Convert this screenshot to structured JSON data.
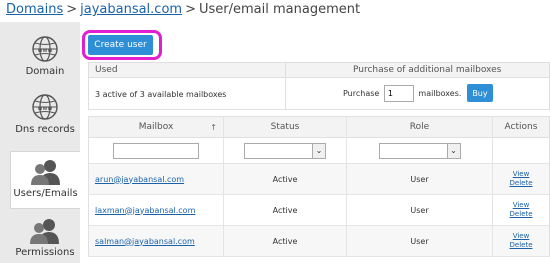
{
  "breadcrumb": {
    "items": [
      "Domains",
      "jayabansal.com"
    ],
    "current": "User/email management",
    "separator": ">"
  },
  "sidebar": {
    "items": [
      {
        "label": "Domain",
        "icon": "globe-icon"
      },
      {
        "label": "Dns records",
        "icon": "globe-icon"
      },
      {
        "label": "Users/Emails",
        "icon": "users-icon",
        "active": true
      },
      {
        "label": "Permissions",
        "icon": "users-icon"
      }
    ]
  },
  "toolbar": {
    "create_label": "Create user"
  },
  "usage": {
    "used_header": "Used",
    "purchase_header": "Purchase of additional mailboxes",
    "used_text": "3 active of 3 available mailboxes",
    "purchase_label": "Purchase",
    "quantity": "1",
    "mailboxes_label": "mailboxes.",
    "buy_label": "Buy"
  },
  "table": {
    "columns": [
      "Mailbox",
      "Status",
      "Role",
      "Actions"
    ],
    "sort_indicator": "↑",
    "filter_dropdown_icon": "chevron-down-icon",
    "rows": [
      {
        "mailbox": "arun@jayabansal.com",
        "status": "Active",
        "role": "User",
        "view": "View",
        "delete": "Delete"
      },
      {
        "mailbox": "laxman@jayabansal.com",
        "status": "Active",
        "role": "User",
        "view": "View",
        "delete": "Delete"
      },
      {
        "mailbox": "salman@jayabansal.com",
        "status": "Active",
        "role": "User",
        "view": "View",
        "delete": "Delete"
      }
    ]
  },
  "colors": {
    "accent": "#2f8fd6",
    "link": "#1a62a8",
    "highlight": "#e21ed1"
  }
}
